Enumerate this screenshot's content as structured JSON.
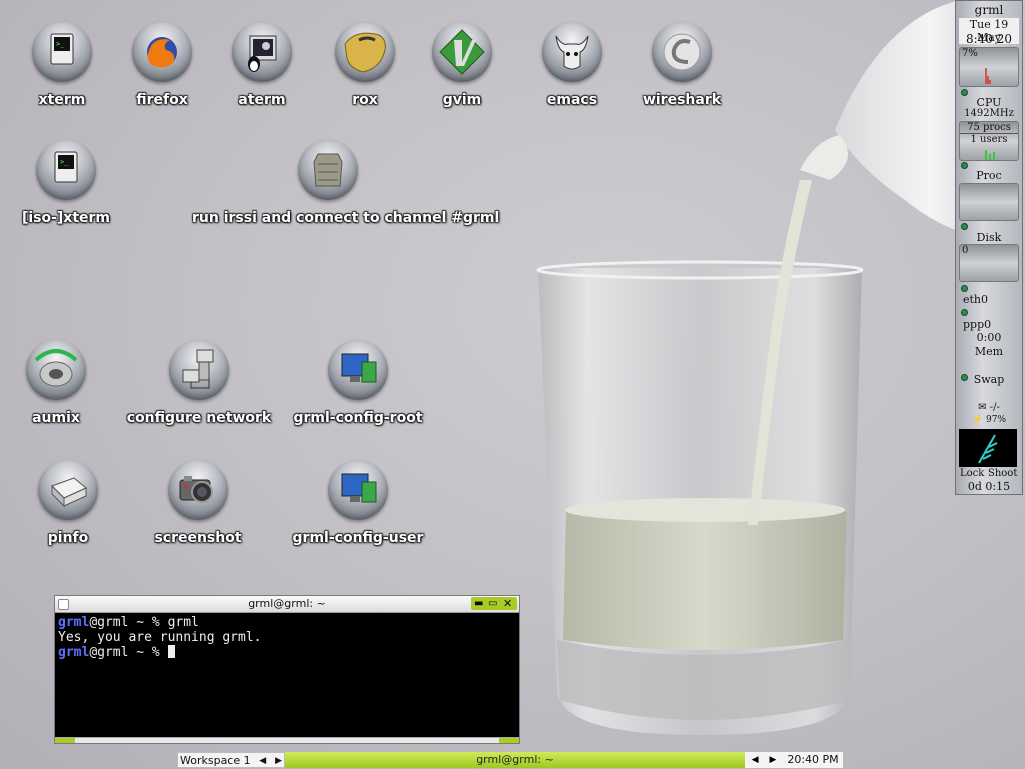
{
  "desktop": {
    "icons_row1": [
      "xterm",
      "firefox",
      "aterm",
      "rox",
      "gvim",
      "emacs",
      "wireshark"
    ],
    "icons_row2": [
      "[iso-]xterm",
      "run irssi and connect to channel #grml"
    ],
    "icons_row3": [
      "aumix",
      "configure network",
      "grml-config-root"
    ],
    "icons_row4": [
      "pinfo",
      "screenshot",
      "grml-config-user"
    ]
  },
  "gkrellm": {
    "host": "grml",
    "date": "Tue 19 May",
    "time": "8:40 20",
    "cpu_chart_label": "7%",
    "cpu_label": "CPU",
    "cpu_freq": "1492MHz",
    "procs": "75 procs",
    "users": "1 users",
    "proc_label": "Proc",
    "disk_label": "Disk",
    "disk_value": "0",
    "eth_label": "eth0",
    "ppp_label": "ppp0",
    "ppp_time": "0:00",
    "mem_label": "Mem",
    "swap_label": "Swap",
    "mail_value": "-/-",
    "battery_value": "97%",
    "lock_label": "Lock",
    "shoot_label": "Shoot",
    "uptime": "0d  0:15"
  },
  "terminal": {
    "title": "grml@grml: ~",
    "line1_user": "grml",
    "line1_rest": "@grml ~ % grml",
    "line2": "Yes, you are running grml.",
    "line3_user": "grml",
    "line3_rest": "@grml ~ % "
  },
  "taskbar": {
    "workspace": "Workspace 1",
    "task": "grml@grml: ~",
    "clock": "20:40 PM"
  }
}
